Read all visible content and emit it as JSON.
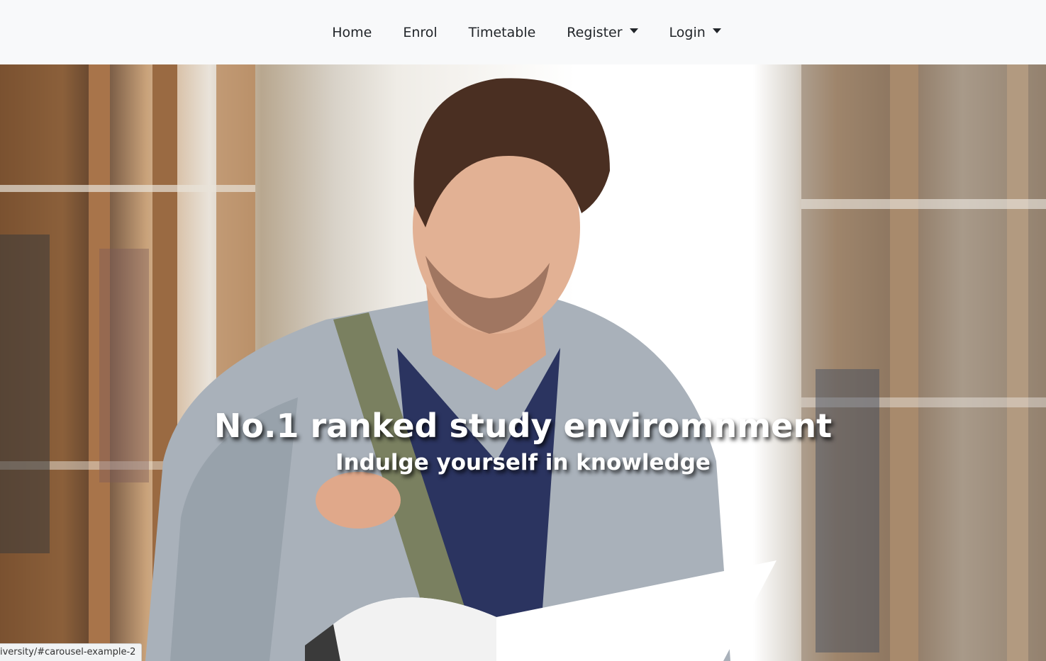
{
  "nav": {
    "items": [
      {
        "label": "Home",
        "dropdown": false
      },
      {
        "label": "Enrol",
        "dropdown": false
      },
      {
        "label": "Timetable",
        "dropdown": false
      },
      {
        "label": "Register",
        "dropdown": true
      },
      {
        "label": "Login",
        "dropdown": true
      }
    ]
  },
  "carousel": {
    "title": "No.1 ranked study enviromnment",
    "subtitle": "Indulge yourself in knowledge"
  },
  "status_bar": {
    "url": "iversity/#carousel-example-2"
  },
  "colors": {
    "navbar_bg": "#f8f9fa",
    "nav_text": "#212529",
    "caption_text": "#ffffff"
  }
}
